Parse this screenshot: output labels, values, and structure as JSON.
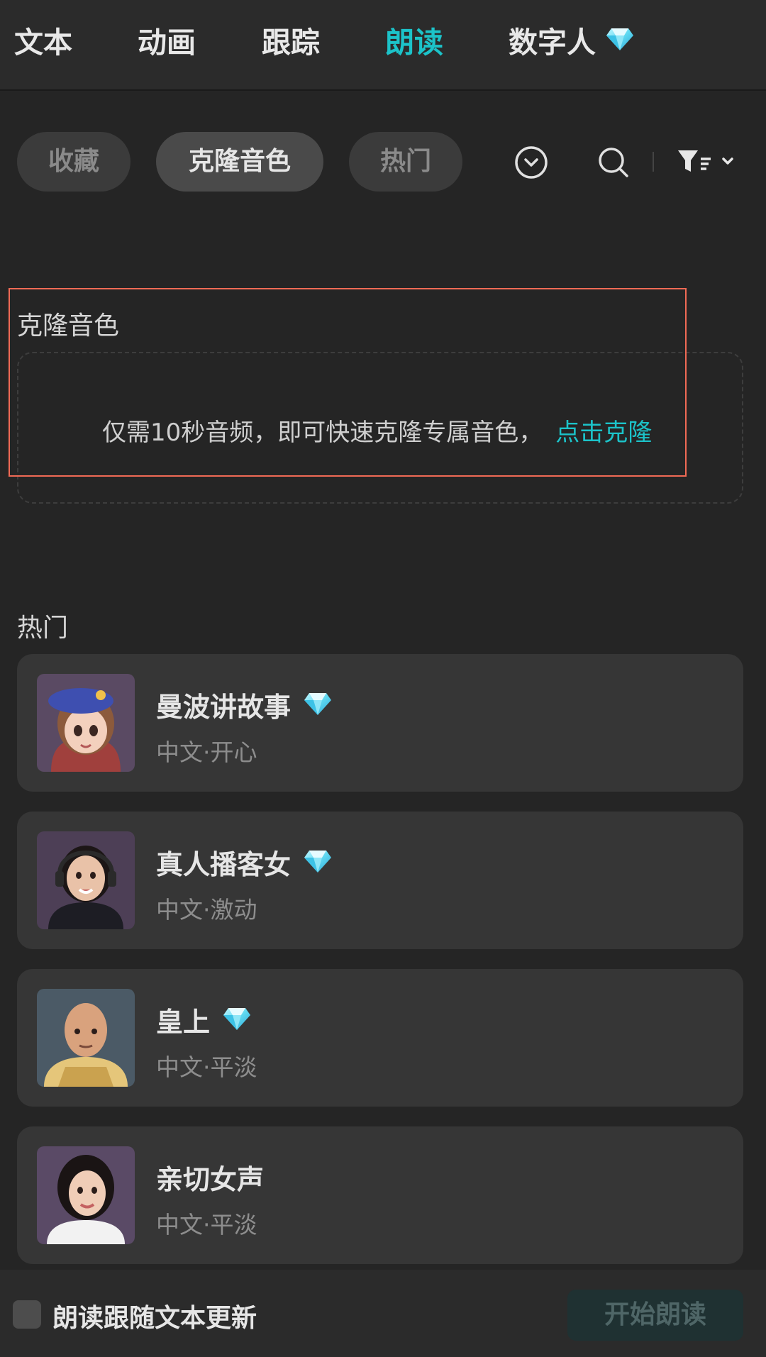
{
  "tabs": [
    {
      "label": "文本"
    },
    {
      "label": "动画"
    },
    {
      "label": "跟踪"
    },
    {
      "label": "朗读",
      "active": true
    },
    {
      "label": "数字人",
      "premium": true
    }
  ],
  "filters": {
    "chips": [
      {
        "label": "收藏"
      },
      {
        "label": "克隆音色",
        "active": true
      },
      {
        "label": "热门"
      }
    ],
    "icons": [
      "chevron-down-circle-icon",
      "search-icon",
      "filter-sort-icon"
    ]
  },
  "clone_section": {
    "title": "克隆音色",
    "description": "仅需10秒音频，即可快速克隆专属音色，",
    "link": "点击克隆"
  },
  "hot_section": {
    "title": "热门",
    "voices": [
      {
        "name": "曼波讲故事",
        "sub": "中文·开心",
        "premium": true
      },
      {
        "name": "真人播客女",
        "sub": "中文·激动",
        "premium": true
      },
      {
        "name": "皇上",
        "sub": "中文·平淡",
        "premium": true
      },
      {
        "name": "亲切女声",
        "sub": "中文·平淡",
        "premium": false
      }
    ]
  },
  "bottom": {
    "checkbox_label": "朗读跟随文本更新",
    "start_button": "开始朗读"
  },
  "colors": {
    "accent": "#1cc3c9",
    "highlight": "#f06a55"
  }
}
